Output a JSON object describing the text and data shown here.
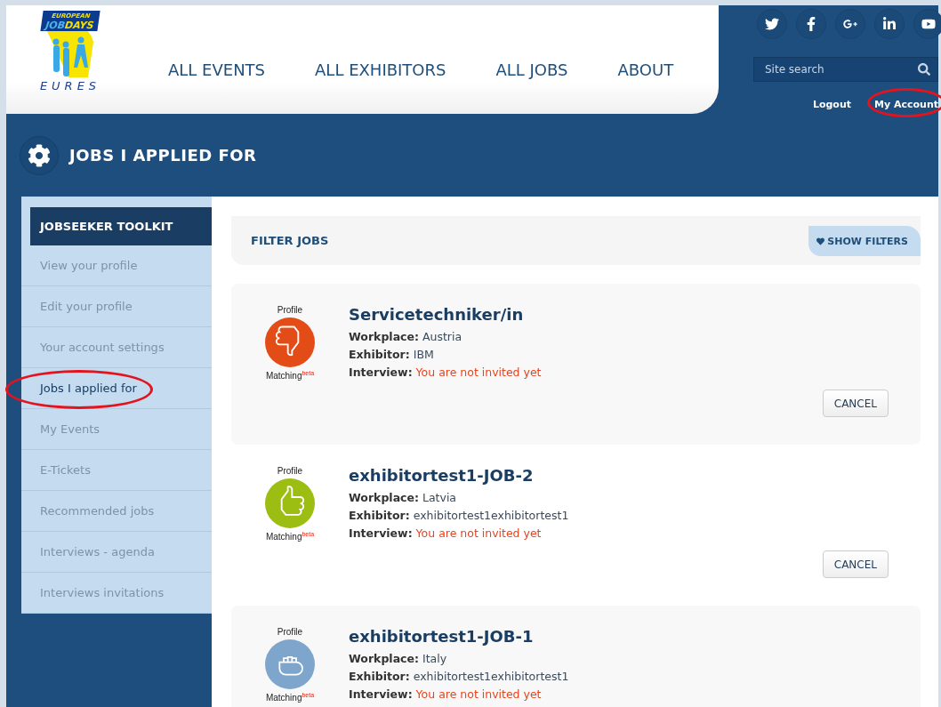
{
  "logo": {
    "top": "EUROPEAN",
    "middle": "JOB",
    "accent": "DAYS",
    "bottom": "EURES"
  },
  "nav": [
    "ALL EVENTS",
    "ALL EXHIBITORS",
    "ALL JOBS",
    "ABOUT"
  ],
  "social": [
    {
      "kind": "twitter"
    },
    {
      "kind": "facebook"
    },
    {
      "kind": "googleplus"
    },
    {
      "kind": "linkedin"
    },
    {
      "kind": "youtube"
    }
  ],
  "search": {
    "placeholder": "Site search"
  },
  "account_links": [
    {
      "label": "Logout",
      "circled": false
    },
    {
      "label": "My Account",
      "circled": true
    }
  ],
  "page_title": "JOBS I APPLIED FOR",
  "sidebar": {
    "title": "JOBSEEKER TOOLKIT",
    "items": [
      {
        "label": "View your profile",
        "selected": false,
        "circled": false
      },
      {
        "label": "Edit your profile",
        "selected": false,
        "circled": false
      },
      {
        "label": "Your account settings",
        "selected": false,
        "circled": false
      },
      {
        "label": "Jobs I applied for",
        "selected": true,
        "circled": true
      },
      {
        "label": "My Events",
        "selected": false,
        "circled": false
      },
      {
        "label": "E-Tickets",
        "selected": false,
        "circled": false
      },
      {
        "label": "Recommended jobs",
        "selected": false,
        "circled": false
      },
      {
        "label": "Interviews - agenda",
        "selected": false,
        "circled": false
      },
      {
        "label": "Interviews invitations",
        "selected": false,
        "circled": false
      }
    ]
  },
  "filter": {
    "title": "FILTER JOBS",
    "toggle": "SHOW FILTERS"
  },
  "jobs": [
    {
      "kind": "negative",
      "match_top": "Profile",
      "match_bottom": "Matching$^{beta}$",
      "title": "Servicetechniker/in",
      "fields": [
        {
          "label": "Workplace:",
          "value": "Austria",
          "kind": "plain"
        },
        {
          "label": "Exhibitor:",
          "value": "IBM",
          "kind": "plain"
        },
        {
          "label": "Interview:",
          "value": "You are not invited yet",
          "kind": "alert"
        }
      ],
      "button": "CANCEL"
    },
    {
      "kind": "positive",
      "match_top": "Profile",
      "match_bottom": "Matching$^{beta}$",
      "title": "exhibitortest1-JOB-2",
      "fields": [
        {
          "label": "Workplace:",
          "value": "Latvia",
          "kind": "plain"
        },
        {
          "label": "Exhibitor:",
          "value": "exhibitortest1exhibitortest1",
          "kind": "plain"
        },
        {
          "label": "Interview:",
          "value": "You are not invited yet",
          "kind": "alert"
        }
      ],
      "button": "CANCEL"
    },
    {
      "kind": "neutral",
      "match_top": "Profile",
      "match_bottom": "Matching$^{beta}$",
      "title": "exhibitortest1-JOB-1",
      "fields": [
        {
          "label": "Workplace:",
          "value": "Italy",
          "kind": "plain"
        },
        {
          "label": "Exhibitor:",
          "value": "exhibitortest1exhibitortest1",
          "kind": "plain"
        },
        {
          "label": "Interview:",
          "value": "You are not invited yet",
          "kind": "alert"
        }
      ]
    }
  ]
}
